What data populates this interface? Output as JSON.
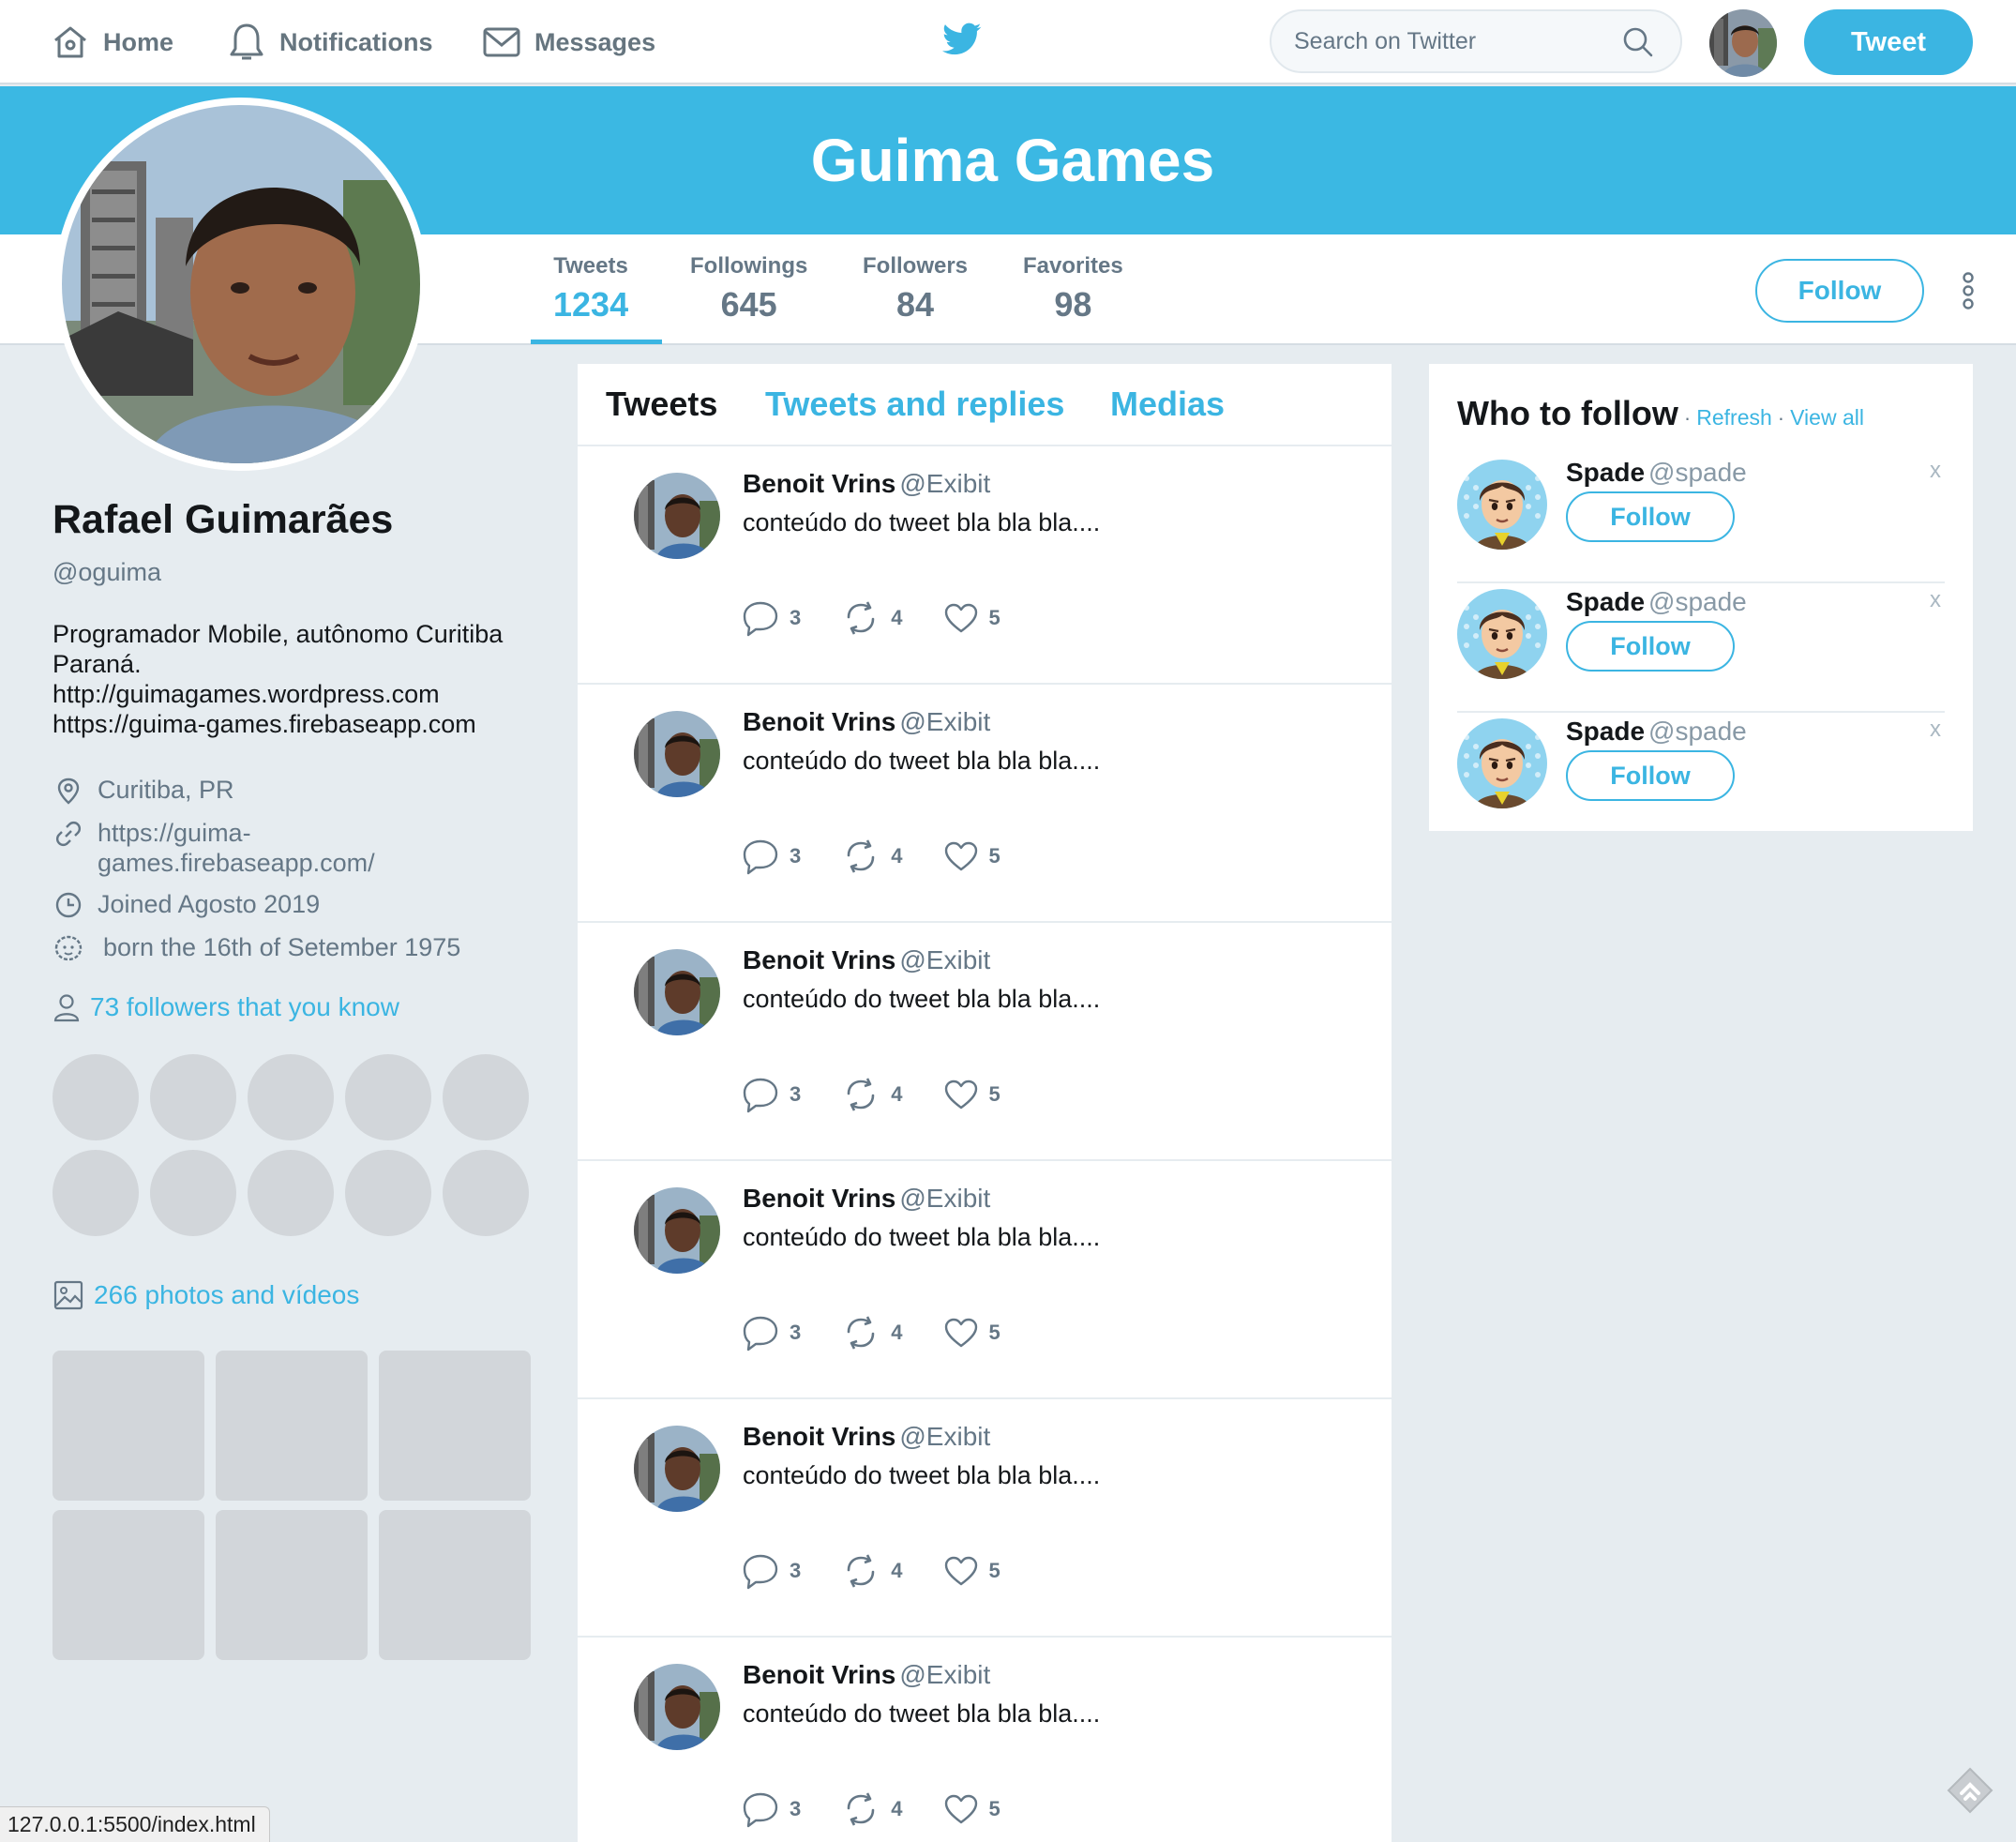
{
  "nav": {
    "home": "Home",
    "notifications": "Notifications",
    "messages": "Messages",
    "search_placeholder": "Search on Twitter",
    "tweet_button": "Tweet",
    "logo_icon": "twitter-bird-icon"
  },
  "banner": {
    "title": "Guima Games"
  },
  "stats": [
    {
      "label": "Tweets",
      "value": "1234"
    },
    {
      "label": "Followings",
      "value": "645"
    },
    {
      "label": "Followers",
      "value": "84"
    },
    {
      "label": "Favorites",
      "value": "98"
    }
  ],
  "profile": {
    "follow_button": "Follow",
    "name": "Rafael Guimarães",
    "handle": "@oguima",
    "bio": "Programador Mobile, autônomo Curitiba Paraná.\nhttp://guimagames.wordpress.com\nhttps://guima-games.firebaseapp.com",
    "location": "Curitiba, PR",
    "website": "https://guima-games.firebaseapp.com/",
    "joined": "Joined Agosto 2019",
    "birthday": "born the 16th of Setember 1975",
    "followers_you_know": "73 followers that you know",
    "photos_videos": "266 photos and vídeos"
  },
  "feed": {
    "tabs": [
      "Tweets",
      "Tweets and replies",
      "Medias"
    ],
    "tweets": [
      {
        "name": "Benoit Vrins",
        "handle": "@Exibit",
        "text": "conteúdo do tweet bla bla bla....",
        "replies": "3",
        "retweets": "4",
        "likes": "5"
      },
      {
        "name": "Benoit Vrins",
        "handle": "@Exibit",
        "text": "conteúdo do tweet bla bla bla....",
        "replies": "3",
        "retweets": "4",
        "likes": "5"
      },
      {
        "name": "Benoit Vrins",
        "handle": "@Exibit",
        "text": "conteúdo do tweet bla bla bla....",
        "replies": "3",
        "retweets": "4",
        "likes": "5"
      },
      {
        "name": "Benoit Vrins",
        "handle": "@Exibit",
        "text": "conteúdo do tweet bla bla bla....",
        "replies": "3",
        "retweets": "4",
        "likes": "5"
      },
      {
        "name": "Benoit Vrins",
        "handle": "@Exibit",
        "text": "conteúdo do tweet bla bla bla....",
        "replies": "3",
        "retweets": "4",
        "likes": "5"
      },
      {
        "name": "Benoit Vrins",
        "handle": "@Exibit",
        "text": "conteúdo do tweet bla bla bla....",
        "replies": "3",
        "retweets": "4",
        "likes": "5"
      }
    ]
  },
  "who_to_follow": {
    "title": "Who to follow",
    "separator": "·",
    "refresh": "Refresh",
    "view_all": "View all",
    "suggestions": [
      {
        "name": "Spade",
        "handle": "@spade",
        "follow": "Follow",
        "close": "x"
      },
      {
        "name": "Spade",
        "handle": "@spade",
        "follow": "Follow",
        "close": "x"
      },
      {
        "name": "Spade",
        "handle": "@spade",
        "follow": "Follow",
        "close": "x"
      }
    ]
  },
  "statusbar": {
    "url": "127.0.0.1:5500/index.html"
  },
  "colors": {
    "accent": "#3bb5e2",
    "banner": "#3bb8e3",
    "background": "#e6ecf0",
    "muted_text": "#657786",
    "placeholder_tile": "#d2d6da"
  }
}
